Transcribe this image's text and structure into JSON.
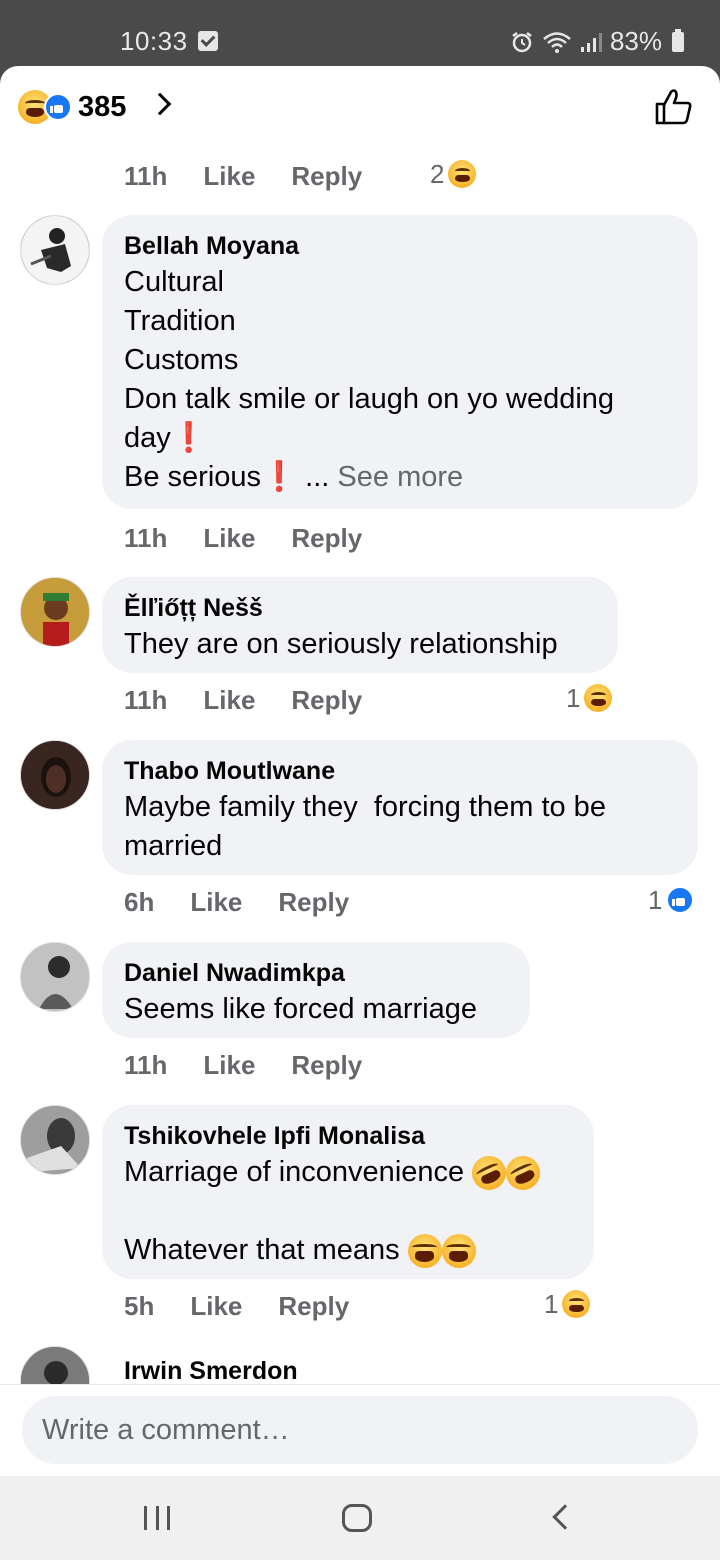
{
  "status_bar": {
    "time": "10:33",
    "battery": "83%"
  },
  "header": {
    "reaction_count": "385"
  },
  "top_meta": {
    "time": "11h",
    "like": "Like",
    "reply": "Reply",
    "reaction_count": "2"
  },
  "comments": [
    {
      "author": "Bellah Moyana",
      "lines": [
        "Cultural",
        "Tradition",
        "Customs",
        "Don talk smile or laugh on yo wedding",
        "day"
      ],
      "last_line": "Be serious",
      "ellipsis": " ... ",
      "see_more": "See more",
      "time": "11h",
      "like": "Like",
      "reply": "Reply"
    },
    {
      "author": "Ělľiőțț Nešš",
      "text": "They are on seriously relationship",
      "time": "11h",
      "like": "Like",
      "reply": "Reply",
      "reaction_count": "1"
    },
    {
      "author": "Thabo Moutlwane",
      "text": "Maybe family they  forcing them to be\nmarried",
      "time": "6h",
      "like": "Like",
      "reply": "Reply",
      "reaction_count": "1"
    },
    {
      "author": "Daniel Nwadimkpa",
      "text": "Seems like forced marriage",
      "time": "11h",
      "like": "Like",
      "reply": "Reply"
    },
    {
      "author": "Tshikovhele Ipfi Monalisa",
      "line1": "Marriage of inconvenience ",
      "line2": "Whatever that means ",
      "time": "5h",
      "like": "Like",
      "reply": "Reply",
      "reaction_count": "1"
    },
    {
      "author": "Irwin Smerdon"
    }
  ],
  "composer": {
    "placeholder": "Write a comment…"
  }
}
